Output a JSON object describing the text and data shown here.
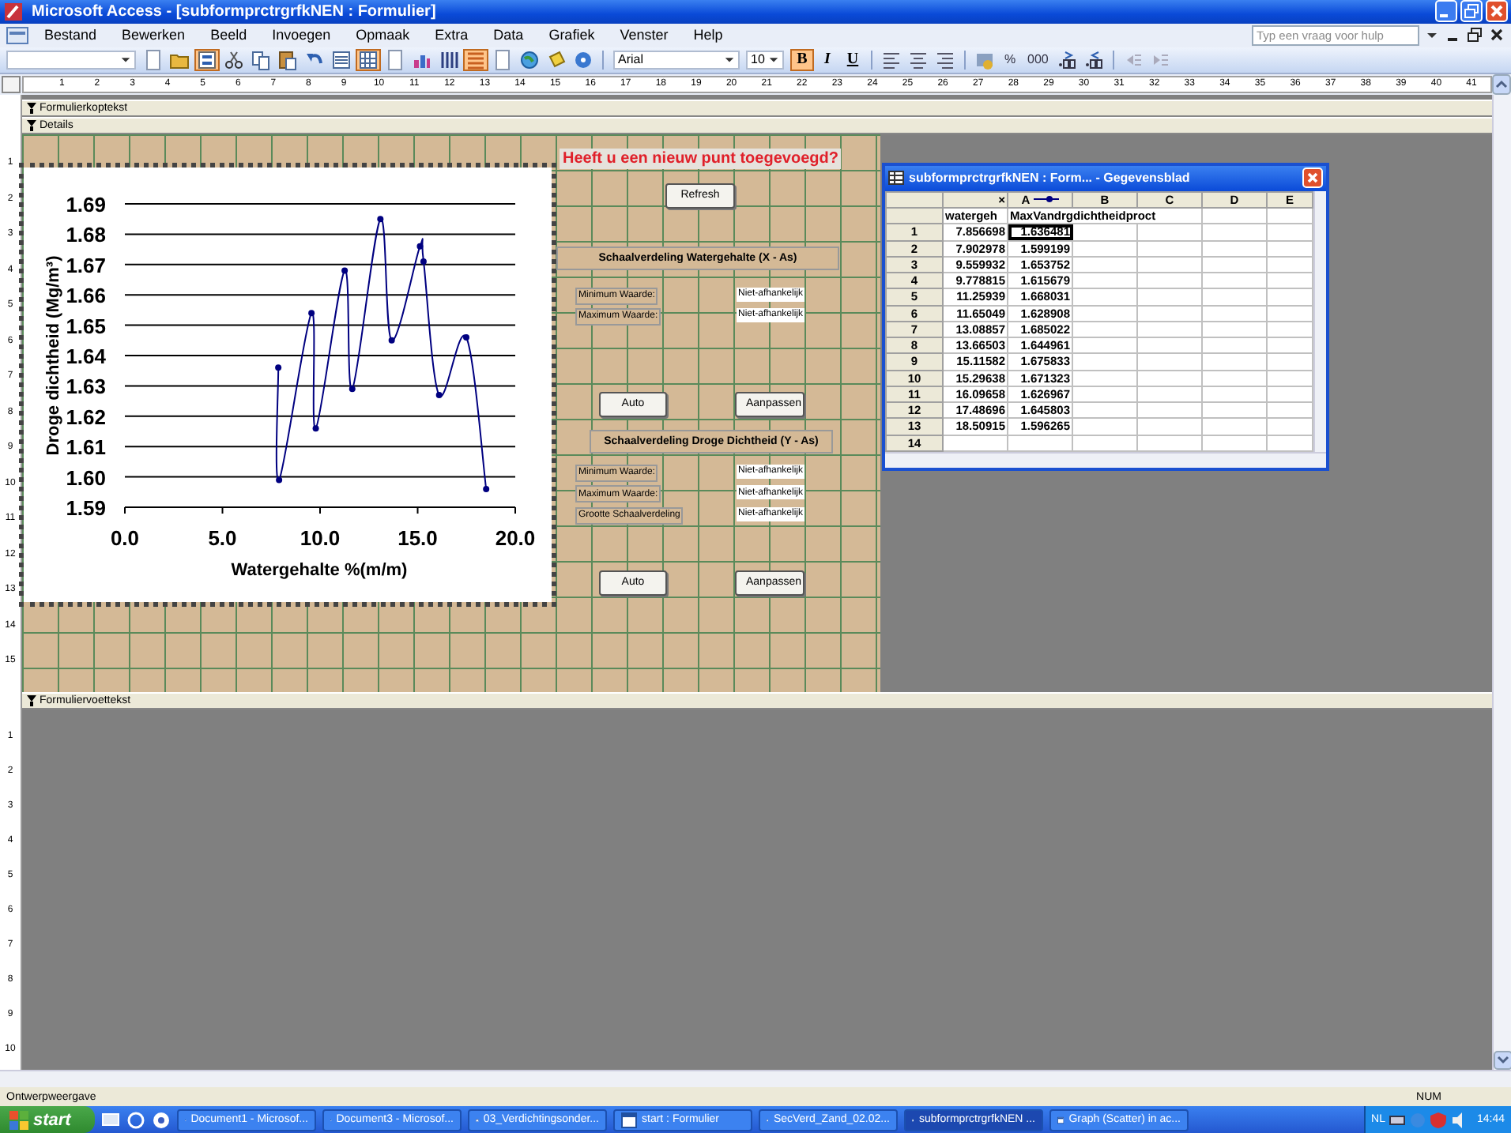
{
  "window": {
    "title": "Microsoft Access - [subformprctrgrfkNEN : Formulier]"
  },
  "menu": {
    "items": [
      "Bestand",
      "Bewerken",
      "Beeld",
      "Invoegen",
      "Opmaak",
      "Extra",
      "Data",
      "Grafiek",
      "Venster",
      "Help"
    ],
    "help_box": {
      "placeholder": "Typ een vraag voor hulp"
    }
  },
  "toolbar": {
    "buttons": [
      {
        "selected": false
      },
      {
        "selected": false
      },
      {
        "selected": true
      },
      {
        "selected": false
      },
      {
        "selected": false
      },
      {
        "selected": false
      },
      {
        "selected": false
      },
      {
        "selected": false
      },
      {
        "selected": true
      },
      {
        "selected": false
      },
      {
        "selected": false
      },
      {
        "selected": false
      },
      {
        "selected": true
      },
      {
        "selected": false
      },
      {
        "selected": false
      },
      {
        "selected": false
      },
      {
        "selected": false
      }
    ]
  },
  "format_toolbar": {
    "font": "Arial",
    "size": "10",
    "styles": [
      {
        "label": "B",
        "selected": true
      },
      {
        "label": "I",
        "selected": false
      },
      {
        "label": "U",
        "selected": false
      }
    ],
    "number_buttons": [
      "%",
      "000"
    ]
  },
  "ruler": {
    "numbers": [
      "1",
      "2",
      "3",
      "4",
      "5",
      "6",
      "7",
      "8",
      "9",
      "10",
      "11",
      "12",
      "13",
      "14",
      "15",
      "16",
      "17",
      "18",
      "19",
      "20",
      "21",
      "22",
      "23",
      "24",
      "25",
      "26",
      "27",
      "28",
      "29",
      "30",
      "31",
      "32",
      "33",
      "34",
      "35",
      "36",
      "37",
      "38",
      "39",
      "40",
      "41"
    ]
  },
  "vertical_ruler": {
    "detail": [
      "1",
      "2",
      "3",
      "4",
      "5",
      "6",
      "7",
      "8",
      "9",
      "10",
      "11",
      "12",
      "13",
      "14",
      "15"
    ],
    "footer": [
      "1",
      "2",
      "3",
      "4",
      "5",
      "6",
      "7",
      "8",
      "9",
      "10"
    ]
  },
  "sections": {
    "header": "Formulierkoptekst",
    "detail": "Details",
    "footer": "Formuliervoettekst"
  },
  "chart": {
    "chart_data": {
      "type": "line",
      "grid": true,
      "xlabel": "Watergehalte %(m/m)",
      "ylabel": "Droge dichtheid (Mg/m³)",
      "x": [
        7.86,
        7.9,
        9.56,
        9.78,
        11.26,
        11.65,
        13.09,
        13.67,
        15.12,
        15.3,
        16.1,
        17.49,
        18.51
      ],
      "series": [
        {
          "color": "#000080",
          "marker": "circle",
          "values": [
            1.636,
            1.599,
            1.654,
            1.616,
            1.668,
            1.629,
            1.685,
            1.645,
            1.676,
            1.671,
            1.627,
            1.646,
            1.596
          ]
        }
      ],
      "xlim": [
        0,
        20
      ],
      "ylim": [
        1.59,
        1.69
      ],
      "xticks": [
        {
          "value": 0,
          "label": "0.0"
        },
        {
          "value": 5,
          "label": "5.0"
        },
        {
          "value": 10,
          "label": "10.0"
        },
        {
          "value": 15,
          "label": "15.0"
        },
        {
          "value": 20,
          "label": "20.0"
        }
      ],
      "yticks": [
        {
          "value": 1.59,
          "label": "1.59"
        },
        {
          "value": 1.6,
          "label": "1.60"
        },
        {
          "value": 1.61,
          "label": "1.61"
        },
        {
          "value": 1.62,
          "label": "1.62"
        },
        {
          "value": 1.63,
          "label": "1.63"
        },
        {
          "value": 1.64,
          "label": "1.64"
        },
        {
          "value": 1.65,
          "label": "1.65"
        },
        {
          "value": 1.66,
          "label": "1.66"
        },
        {
          "value": 1.67,
          "label": "1.67"
        },
        {
          "value": 1.68,
          "label": "1.68"
        },
        {
          "value": 1.69,
          "label": "1.69"
        }
      ]
    }
  },
  "form": {
    "prompt": "Heeft u een nieuw punt toegevoegd?",
    "refresh_button": "Refresh",
    "x_axis_group": {
      "title": "Schaalverdeling Watergehalte (X - As)",
      "fields": [
        {
          "label": "Minimum Waarde:",
          "value": "Niet-afhankelijk"
        },
        {
          "label": "Maximum Waarde:",
          "value": "Niet-afhankelijk"
        }
      ],
      "buttons": [
        "Auto",
        "Aanpassen"
      ]
    },
    "y_axis_group": {
      "title": "Schaalverdeling Droge Dichtheid (Y - As)",
      "fields": [
        {
          "label": "Minimum Waarde:",
          "value": "Niet-afhankelijk"
        },
        {
          "label": "Maximum Waarde:",
          "value": "Niet-afhankelijk"
        },
        {
          "label": "Grootte Schaalverdeling",
          "value": "Niet-afhankelijk"
        }
      ],
      "buttons": [
        "Auto",
        "Aanpassen"
      ]
    }
  },
  "datasheet": {
    "title": "subformprctrgrfkNEN : Form... - Gegevensblad",
    "column_letters": [
      "×",
      "A",
      "B",
      "C",
      "D",
      "E"
    ],
    "field_names": [
      "watergeh",
      "MaxVandrgdichtheidproct"
    ],
    "rows": [
      {
        "number": "1",
        "values": [
          "7.856698",
          "1.636481"
        ],
        "focused": true
      },
      {
        "number": "2",
        "values": [
          "7.902978",
          "1.599199"
        ],
        "focused": false
      },
      {
        "number": "3",
        "values": [
          "9.559932",
          "1.653752"
        ],
        "focused": false
      },
      {
        "number": "4",
        "values": [
          "9.778815",
          "1.615679"
        ],
        "focused": false
      },
      {
        "number": "5",
        "values": [
          "11.25939",
          "1.668031"
        ],
        "focused": false
      },
      {
        "number": "6",
        "values": [
          "11.65049",
          "1.628908"
        ],
        "focused": false
      },
      {
        "number": "7",
        "values": [
          "13.08857",
          "1.685022"
        ],
        "focused": false
      },
      {
        "number": "8",
        "values": [
          "13.66503",
          "1.644961"
        ],
        "focused": false
      },
      {
        "number": "9",
        "values": [
          "15.11582",
          "1.675833"
        ],
        "focused": false
      },
      {
        "number": "10",
        "values": [
          "15.29638",
          "1.671323"
        ],
        "focused": false
      },
      {
        "number": "11",
        "values": [
          "16.09658",
          "1.626967"
        ],
        "focused": false
      },
      {
        "number": "12",
        "values": [
          "17.48696",
          "1.645803"
        ],
        "focused": false
      },
      {
        "number": "13",
        "values": [
          "18.50915",
          "1.596265"
        ],
        "focused": false
      },
      {
        "number": "14",
        "focused": false
      }
    ]
  },
  "status_bar": {
    "mode": "Ontwerpweergave",
    "indicator": "NUM"
  },
  "taskbar": {
    "start": "start",
    "tasks": [
      {
        "label": "Document1 - Microsof...",
        "selected": false
      },
      {
        "label": "Document3 - Microsof...",
        "selected": false
      },
      {
        "label": "03_Verdichtingsonder...",
        "selected": false
      },
      {
        "label": "start : Formulier",
        "selected": false
      },
      {
        "label": "SecVerd_Zand_02.02...",
        "selected": false
      },
      {
        "label": "subformprctrgrfkNEN ...",
        "selected": true
      },
      {
        "label": "Graph (Scatter) in ac...",
        "selected": false
      }
    ],
    "language": "NL",
    "clock": "14:44"
  }
}
